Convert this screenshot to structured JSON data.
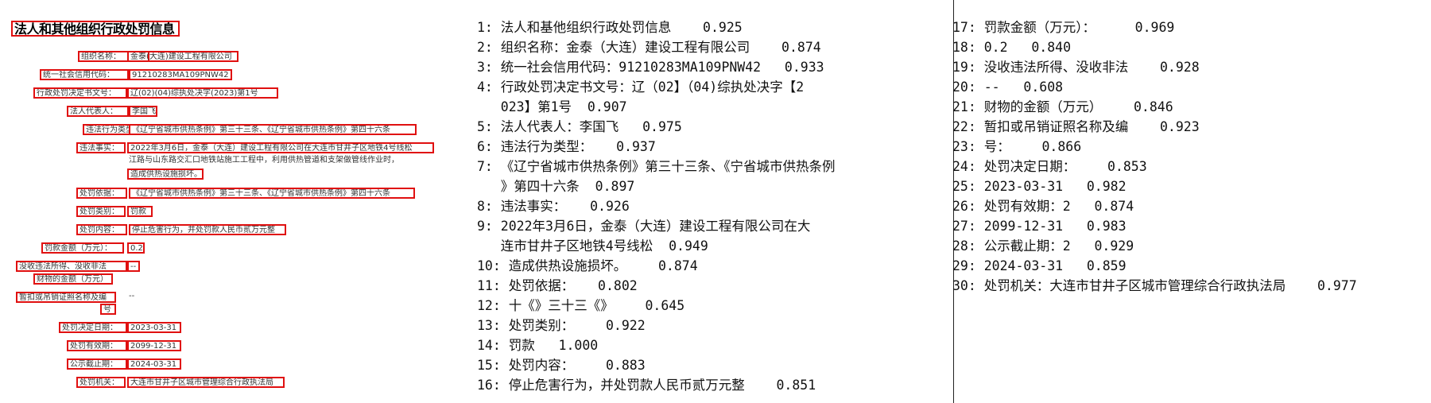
{
  "document": {
    "title": "法人和其他组织行政处罚信息",
    "fields": [
      {
        "label": "组织名称：",
        "value": "金泰(大连)建设工程有限公司"
      },
      {
        "label": "统一社会信用代码：",
        "value": "91210283MA109PNW42"
      },
      {
        "label": "行政处罚决定书文号：",
        "value": "辽(02)(04)综执处决字(2023)第1号"
      },
      {
        "label": "法人代表人：",
        "value": "李国飞"
      },
      {
        "label": "违法行为类型：",
        "value": "《辽宁省城市供热条例》第三十三条、《辽宁省城市供热条例》第四十六条"
      },
      {
        "label": "违法事实：",
        "value": "2022年3月6日，金泰（大连）建设工程有限公司在大连市甘井子区地铁4号线松"
      },
      {
        "label": "",
        "value": "江路与山东路交汇口地铁站施工工程中，利用供热管道和支架做管线作业时，"
      },
      {
        "label": "",
        "value": "造成供热设施损坏。"
      },
      {
        "label": "处罚依据：",
        "value": "《辽宁省城市供热条例》第三十三条、《辽宁省城市供热条例》第四十六条"
      },
      {
        "label": "处罚类别：",
        "value": "罚款"
      },
      {
        "label": "处罚内容：",
        "value": "停止危害行为，并处罚款人民币贰万元整"
      },
      {
        "label": "罚款金额（万元）：",
        "value": "0.2"
      },
      {
        "label": "没收违法所得、没收非法",
        "value": "--"
      },
      {
        "label": "财物的金额（万元）",
        "value": ""
      },
      {
        "label": "暂扣或吊销证照名称及编",
        "value": "--"
      },
      {
        "label": "号",
        "value": ""
      },
      {
        "label": "处罚决定日期：",
        "value": "2023-03-31"
      },
      {
        "label": "处罚有效期：",
        "value": "2099-12-31"
      },
      {
        "label": "公示截止期：",
        "value": "2024-03-31"
      },
      {
        "label": "处罚机关：",
        "value": "大连市甘井子区城市管理综合行政执法局"
      }
    ]
  },
  "ocr_results": {
    "middle": [
      "1: 法人和基他组织行政处罚信息    0.925",
      "2: 组织名称：金泰（大连）建设工程有限公司    0.874",
      "3: 统一社会信用代码：91210283MA109PNW42   0.933",
      "4: 行政处罚决定书文号：辽（02】（04)综执处决字【2",
      "   023】第1号  0.907",
      "5: 法人代表人：李国飞   0.975",
      "6: 违法行为类型：   0.937",
      "7: 《辽宁省城市供热条例》第三十三条、《宁省城市供热条例",
      "   》第四十六条  0.897",
      "8: 违法事实：   0.926",
      "9: 2022年3月6日，金泰（大连）建设工程有限公司在大",
      "   连市甘井子区地铁4号线松  0.949",
      "10: 造成供热设施损坏。    0.874",
      "11: 处罚依据：   0.802",
      "12: 十《》三十三《》    0.645",
      "13: 处罚类别：    0.922",
      "14: 罚款   1.000",
      "15: 处罚内容：    0.883",
      "16: 停止危害行为，并处罚款人民币贰万元整    0.851"
    ],
    "right": [
      "17: 罚款金额（万元）：     0.969",
      "18: 0.2   0.840",
      "19: 没收违法所得、没收非法    0.928",
      "20: --   0.608",
      "21: 财物的金额（万元）    0.846",
      "22: 暂扣或吊销证照名称及编    0.923",
      "23: 号：    0.866",
      "24: 处罚决定日期：    0.853",
      "25: 2023-03-31   0.982",
      "26: 处罚有效期：2   0.874",
      "27: 2099-12-31   0.983",
      "28: 公示截止期：2   0.929",
      "29: 2024-03-31   0.859",
      "30: 处罚机关：大连市甘井子区城市管理综合行政执法局    0.977"
    ]
  }
}
